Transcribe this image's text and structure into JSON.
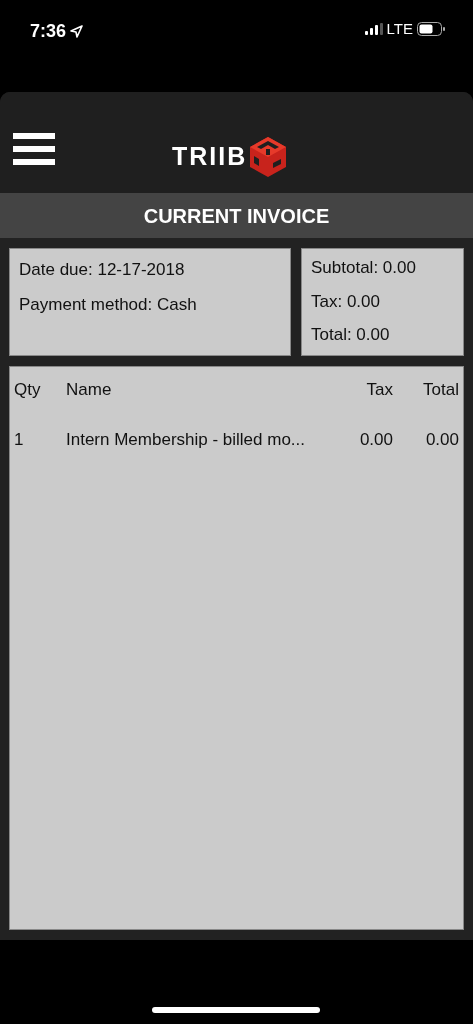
{
  "status_bar": {
    "time": "7:36",
    "network": "LTE"
  },
  "header": {
    "logo_text": "TRIIB"
  },
  "title": "CURRENT INVOICE",
  "details": [
    "Date due: 12-17-2018",
    "Payment method: Cash"
  ],
  "totals": [
    "Subtotal: 0.00",
    "Tax: 0.00",
    "Total: 0.00"
  ],
  "table": {
    "columns": [
      "Qty",
      "Name",
      "Tax",
      "Total"
    ],
    "rows": [
      [
        "1",
        "Intern Membership - billed mo...",
        "0.00",
        "0.00"
      ]
    ]
  }
}
